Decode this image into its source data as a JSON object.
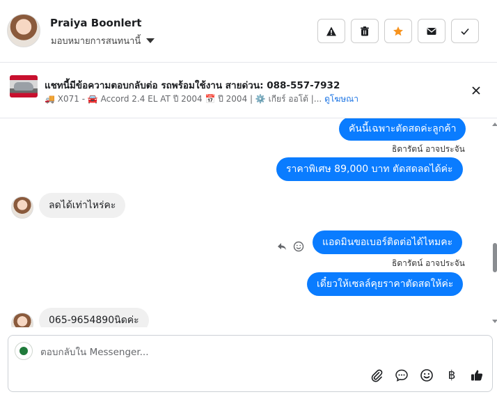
{
  "header": {
    "contact_name": "Praiya Boonlert",
    "assign_label": "มอบหมายการสนทนานี้",
    "buttons": [
      {
        "icon": "warning-icon"
      },
      {
        "icon": "trash-icon"
      },
      {
        "icon": "star-icon",
        "color": "#f7931e"
      },
      {
        "icon": "envelope-icon"
      },
      {
        "icon": "checkmark-icon"
      }
    ]
  },
  "ad": {
    "title": "แชทนี้มีข้อความตอบกลับต่อ รถพร้อมใช้งาน สายด่วน: 088-557-7932",
    "subtitle": "🚚 X071 - 🚘 Accord 2.4 EL AT ปี 2004 📅 ปี 2004 | ⚙️ เกียร์ ออโต้ |...",
    "link": "ดูโฆษณา"
  },
  "messages": {
    "m1": "คันนี้เฉพาะตัดสดค่ะลูกค้า",
    "m1_sender": "ธิดารัตน์ อาจประจัน",
    "m2": "ราคาพิเศษ 89,000 บาท ตัดสดลดได้ค่ะ",
    "m3": "ลดได้เท่าไหร่คะ",
    "m4": "แอดมินขอเบอร์ติดต่อได้ไหมคะ",
    "m4_sender": "ธิดารัตน์ อาจประจัน",
    "m5": "เดี๋ยวให้เซลล์คุยราคาตัดสดให้ค่ะ",
    "m6": "065-9654890นิดค่ะ"
  },
  "composer": {
    "placeholder": "ตอบกลับใน Messenger...",
    "baht_symbol": "฿"
  },
  "colors": {
    "outgoing_bubble": "#0a7cff",
    "incoming_bubble": "#f0f0f0",
    "link": "#1b74e4"
  }
}
